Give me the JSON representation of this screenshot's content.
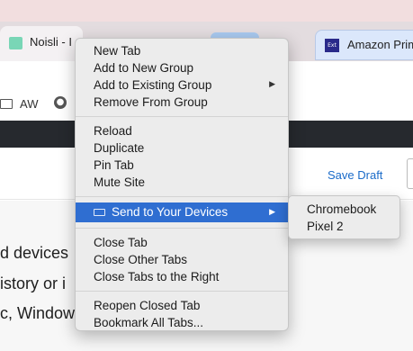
{
  "tabs": [
    {
      "title": "Noisli - I"
    },
    {
      "title": "Amazon Prim",
      "favicon_text": "Ext"
    }
  ],
  "bookmarks": {
    "folder_label": "AW"
  },
  "page": {
    "save_draft": "Save Draft",
    "content_lines": [
      "d devices",
      "istory or i",
      "c, Windows"
    ]
  },
  "context_menu": {
    "group1": [
      "New Tab",
      "Add to New Group",
      "Add to Existing Group",
      "Remove From Group"
    ],
    "group2": [
      "Reload",
      "Duplicate",
      "Pin Tab",
      "Mute Site"
    ],
    "send": "Send to Your Devices",
    "group4": [
      "Close Tab",
      "Close Other Tabs",
      "Close Tabs to the Right"
    ],
    "group5": [
      "Reopen Closed Tab",
      "Bookmark All Tabs..."
    ]
  },
  "submenu": {
    "devices": [
      "Chromebook",
      "Pixel 2"
    ]
  },
  "colors": {
    "highlight": "#2f6ed1",
    "menu_bg": "#ececec",
    "link": "#1a6bc9"
  },
  "icons": {
    "submenu_arrow": "triangle-right",
    "send_to_devices": "laptop-icon",
    "folder": "folder-icon",
    "globe": "globe-icon"
  }
}
